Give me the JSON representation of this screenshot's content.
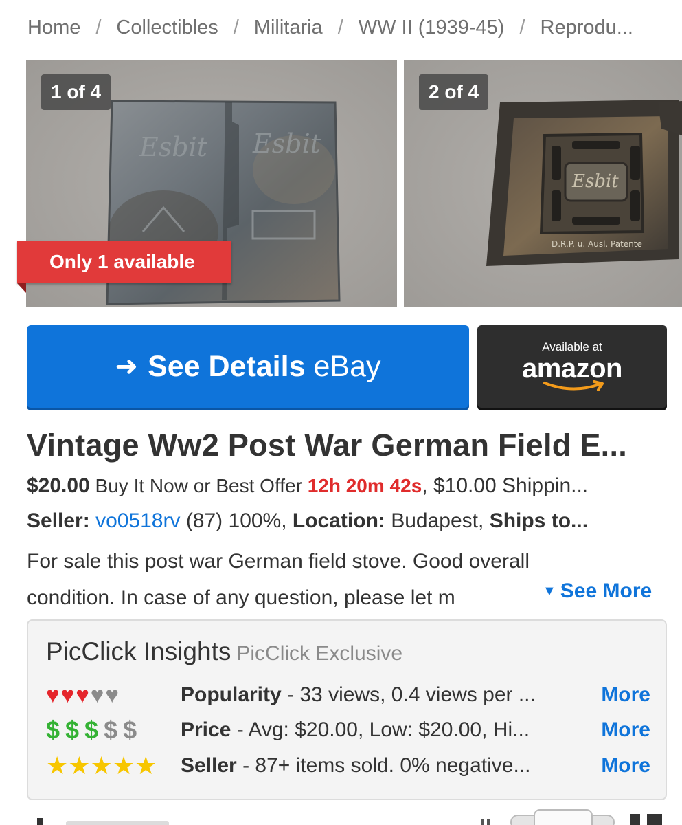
{
  "breadcrumb": [
    {
      "label": "Home"
    },
    {
      "label": "Collectibles"
    },
    {
      "label": "Militaria"
    },
    {
      "label": "WW II (1939-45)"
    },
    {
      "label": "Reprodu..."
    }
  ],
  "gallery": {
    "photo1_counter": "1 of 4",
    "photo2_counter": "2 of 4",
    "availability_ribbon": "Only 1 available",
    "photo2_stamp": "D.R.P. u. Ausl. Patente"
  },
  "buttons": {
    "ebay_bold": "See Details",
    "ebay_normal": "eBay",
    "amazon_small": "Available at",
    "amazon_brand": "amazon"
  },
  "item": {
    "title": "Vintage Ww2 Post War German Field E...",
    "price": "$20.00",
    "buy_format": " Buy It Now or Best Offer ",
    "time_left": "12h 20m 42s",
    "shipping": ", $10.00 Shippin...",
    "seller_label": "Seller:",
    "seller_name": "vo0518rv",
    "seller_stats": " (87) 100%, ",
    "location_label": "Location:",
    "location": " Budapest, ",
    "ships_label": "Ships to...",
    "description_l1": "For sale this post war German field stove. Good overall",
    "description_l2": "condition. In case of any question, please let m",
    "see_more": "See More"
  },
  "insights": {
    "title": "PicClick Insights",
    "exclusive": "PicClick Exclusive",
    "popularity": {
      "label": "Popularity",
      "text": " - 33 views, 0.4 views per ...",
      "more": "More",
      "hearts_on": 3,
      "hearts_total": 5
    },
    "price": {
      "label": "Price",
      "text": " - Avg: $20.00, Low: $20.00, Hi...",
      "more": "More",
      "dollars_on": 3,
      "dollars_total": 5
    },
    "seller": {
      "label": "Seller",
      "text": " - 87+ items sold. 0% negative...",
      "more": "More",
      "stars_on": 5,
      "stars_total": 5
    }
  },
  "colors": {
    "ebay_blue": "#0f74da",
    "amazon_dark": "#2e2e2e",
    "ribbon_red": "#e13a3a",
    "timer_red": "#e02c2c",
    "heart_red": "#e5262c",
    "dollar_green": "#34b234",
    "star_yellow": "#f7c600"
  }
}
